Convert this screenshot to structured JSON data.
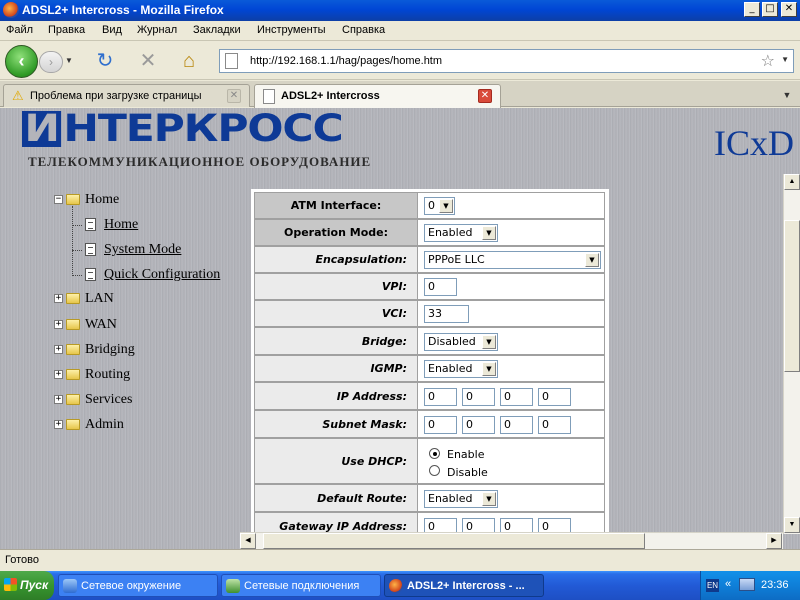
{
  "window": {
    "title": "ADSL2+ Intercross - Mozilla Firefox",
    "min_btn": "_",
    "max_btn": "□",
    "close_btn": "✕"
  },
  "menu": {
    "items": [
      "Файл",
      "Правка",
      "Вид",
      "Журнал",
      "Закладки",
      "Инструменты",
      "Справка"
    ]
  },
  "navbar": {
    "back_glyph": "‹",
    "forward_glyph": "›",
    "reload_glyph": "↻",
    "stop_glyph": "✕",
    "home_glyph": "⌂",
    "url": "http://192.168.1.1/hag/pages/home.htm",
    "star_glyph": "☆"
  },
  "tabs": [
    {
      "label": "Проблема при загрузке страницы",
      "icon": "warning-icon",
      "active": false
    },
    {
      "label": "ADSL2+ Intercross",
      "icon": "page-icon",
      "active": true
    }
  ],
  "header": {
    "logo_text": "ИНТЕРКРОСС",
    "logo_mark": "И",
    "logo_rest": "НТЕРКРОСС",
    "slogan": "ТЕЛЕКОММУНИКАЦИОННОЕ ОБОРУДОВАНИЕ",
    "right_text": "ICxD"
  },
  "tree": {
    "root": {
      "label": "Home",
      "expander": "−"
    },
    "children": [
      "Home",
      "System Mode",
      "Quick Configuration"
    ],
    "sections": [
      {
        "label": "LAN",
        "expander": "+"
      },
      {
        "label": "WAN",
        "expander": "+"
      },
      {
        "label": "Bridging",
        "expander": "+"
      },
      {
        "label": "Routing",
        "expander": "+"
      },
      {
        "label": "Services",
        "expander": "+"
      },
      {
        "label": "Admin",
        "expander": "+"
      }
    ]
  },
  "form": {
    "atm_interface": {
      "label": "ATM Interface:",
      "value": "0"
    },
    "operation_mode": {
      "label": "Operation Mode:",
      "value": "Enabled"
    },
    "encapsulation": {
      "label": "Encapsulation:",
      "value": "PPPoE LLC"
    },
    "vpi": {
      "label": "VPI:",
      "value": "0"
    },
    "vci": {
      "label": "VCI:",
      "value": "33"
    },
    "bridge": {
      "label": "Bridge:",
      "value": "Disabled"
    },
    "igmp": {
      "label": "IGMP:",
      "value": "Enabled"
    },
    "ip_address": {
      "label": "IP Address:",
      "octets": [
        "0",
        "0",
        "0",
        "0"
      ]
    },
    "subnet_mask": {
      "label": "Subnet Mask:",
      "octets": [
        "0",
        "0",
        "0",
        "0"
      ]
    },
    "use_dhcp": {
      "label": "Use DHCP:",
      "options": [
        "Enable",
        "Disable"
      ],
      "selected": "Enable"
    },
    "default_route": {
      "label": "Default Route:",
      "value": "Enabled"
    },
    "gateway_ip": {
      "label": "Gateway IP Address:",
      "octets": [
        "0",
        "0",
        "0",
        "0"
      ]
    }
  },
  "status": {
    "text": "Готово"
  },
  "taskbar": {
    "start": "Пуск",
    "tasks": [
      {
        "label": "Сетевое окружение",
        "active": false
      },
      {
        "label": "Сетевые подключения",
        "active": false
      },
      {
        "label": "ADSL2+ Intercross - ...",
        "active": true
      }
    ],
    "lang": "EN",
    "chevron": "«",
    "clock": "23:36"
  },
  "colors": {
    "brand": "#0e3a96",
    "titlebar": "#0a5ad8",
    "taskbar": "#245edb",
    "start": "#37952f"
  }
}
